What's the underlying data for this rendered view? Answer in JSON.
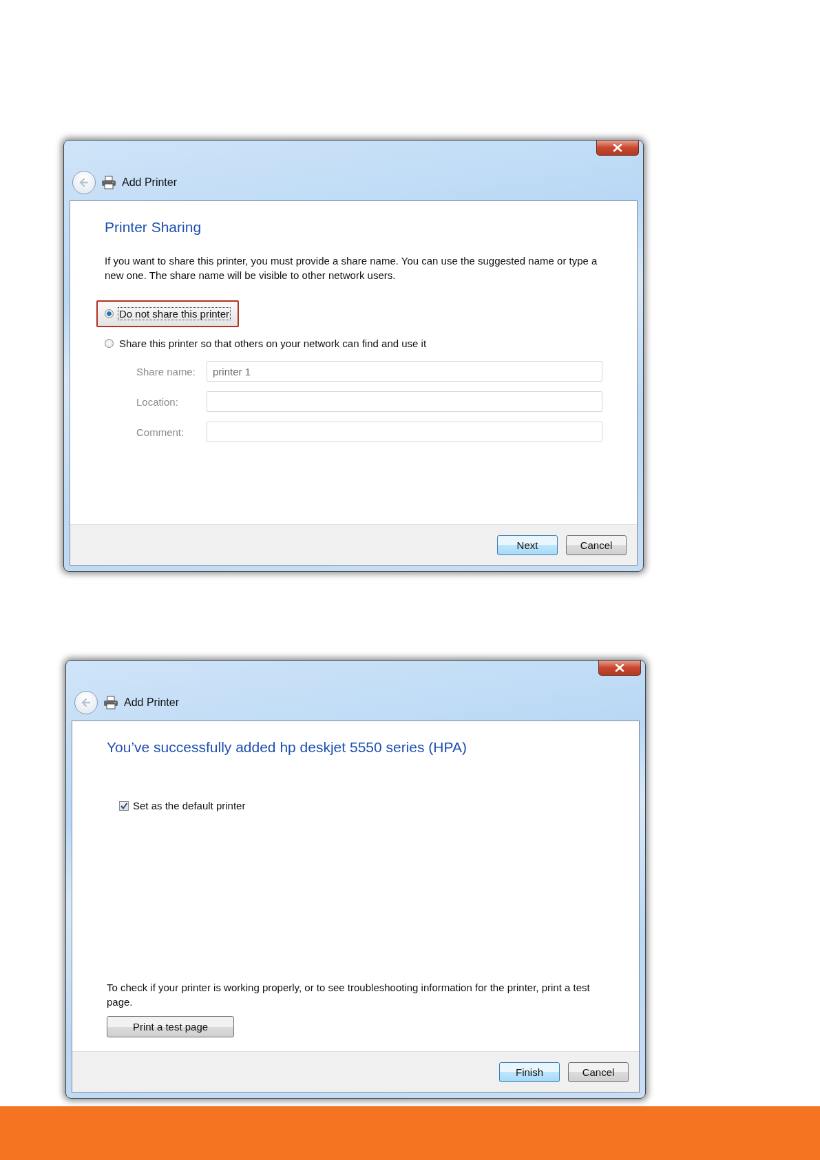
{
  "dialogs": [
    {
      "title": "Add Printer",
      "heading": "Printer Sharing",
      "intro": "If you want to share this printer, you must provide a share name. You can use the suggested name or type a new one. The share name will be visible to other network users.",
      "options": [
        {
          "label": "Do not share this printer",
          "selected": true,
          "highlighted": true
        },
        {
          "label": "Share this printer so that others on your network can find and use it",
          "selected": false,
          "highlighted": false
        }
      ],
      "fields": [
        {
          "label": "Share name:",
          "value": "printer 1",
          "disabled": true
        },
        {
          "label": "Location:",
          "disabled": true
        },
        {
          "label": "Comment:",
          "disabled": true
        }
      ],
      "buttons": [
        {
          "label": "Next",
          "default": true
        },
        {
          "label": "Cancel",
          "default": false
        }
      ]
    },
    {
      "title": "Add Printer",
      "heading": "You’ve successfully added hp deskjet 5550 series (HPA)",
      "checkbox": {
        "label": "Set as the default printer",
        "checked": true
      },
      "note": "To check if your printer is working properly, or to see troubleshooting information for the printer, print a test page.",
      "action": "Print a test page",
      "buttons": [
        {
          "label": "Finish",
          "default": true
        },
        {
          "label": "Cancel",
          "default": false
        }
      ]
    }
  ]
}
